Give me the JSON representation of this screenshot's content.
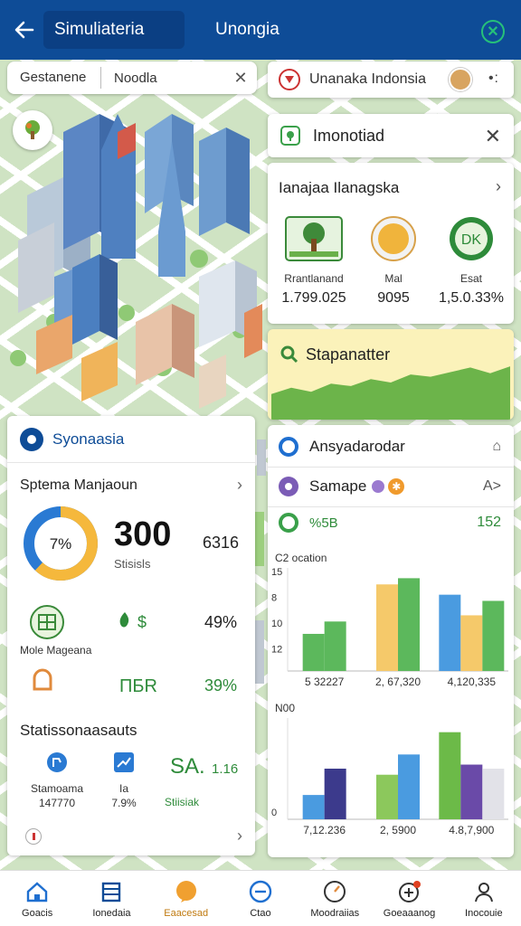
{
  "topbar": {
    "title_left": "Simuliateria",
    "title_center": "Unongia"
  },
  "search": {
    "scope": "Gestanene",
    "query": "Noodla"
  },
  "location_card": {
    "label": "Unanaka Indonsia"
  },
  "info_card": {
    "label": "Imonotiad"
  },
  "management_card": {
    "title": "Ianajaa Ilanagska",
    "items": [
      {
        "label": "Rrantlanand",
        "value": "1.799.025",
        "icon": "tree-icon"
      },
      {
        "label": "Mal",
        "value": "9095",
        "icon": "sun-icon"
      },
      {
        "label": "Esat",
        "value": "1,5.0.33%",
        "icon": "badge-icon",
        "badge_text": "DK"
      }
    ]
  },
  "stat_card": {
    "title": "Stapanatter",
    "area_values": [
      44,
      55,
      48,
      62,
      58,
      70,
      64,
      78,
      74,
      82,
      90,
      80,
      92
    ]
  },
  "right_rows": [
    {
      "label": "Ansyadarodar",
      "tail": "⌂"
    },
    {
      "label": "Samape",
      "tail": "A>"
    },
    {
      "label": "%5B",
      "tail": "152"
    }
  ],
  "chart_data": [
    {
      "type": "bar",
      "title": "C2 ocation",
      "yticks": [
        "15",
        "8",
        "10",
        "12"
      ],
      "categories": [
        "5 32227",
        "2, 67,320",
        "4,120,335"
      ],
      "series": [
        {
          "values": [
            36,
            84,
            70
          ],
          "color": "#5cb85c"
        },
        {
          "values": [
            48,
            0,
            0
          ],
          "color": "#f5c96a"
        },
        {
          "values": [
            0,
            0,
            56
          ],
          "color": "#4a9be0"
        }
      ],
      "bars": [
        [
          {
            "v": 36,
            "c": "#5cb85c"
          },
          {
            "v": 48,
            "c": "#5cb85c"
          }
        ],
        [
          {
            "v": 84,
            "c": "#f5c96a"
          },
          {
            "v": 90,
            "c": "#5cb85c"
          }
        ],
        [
          {
            "v": 74,
            "c": "#4a9be0"
          },
          {
            "v": 54,
            "c": "#f5c96a"
          },
          {
            "v": 68,
            "c": "#5cb85c"
          }
        ]
      ],
      "ylim": [
        0,
        100
      ]
    },
    {
      "type": "bar",
      "title": "N00",
      "yticks": [
        "0"
      ],
      "categories": [
        "7,12.236",
        "2, 5900",
        "4.8,7,900"
      ],
      "bars": [
        [
          {
            "v": 24,
            "c": "#4a9be0"
          },
          {
            "v": 50,
            "c": "#3c3a8c"
          }
        ],
        [
          {
            "v": 44,
            "c": "#8cc85c"
          },
          {
            "v": 64,
            "c": "#4a9be0"
          }
        ],
        [
          {
            "v": 86,
            "c": "#6cba48"
          },
          {
            "v": 54,
            "c": "#6a4aa8"
          },
          {
            "v": 50,
            "c": "#e2e2e8"
          }
        ]
      ],
      "ylim": [
        0,
        100
      ]
    }
  ],
  "left_card": {
    "title": "Syonaasia",
    "subtitle": "Sptema Manjaoun",
    "donut_label": "7%",
    "donut_percent": 62,
    "big_number": "300",
    "big_label": "Stisisls",
    "side_pct": "6316",
    "row1": {
      "caption": "Mole Mageana",
      "pct": "49%",
      "mid": "$"
    },
    "row2": {
      "mid": "ПБR",
      "pct": "39%"
    },
    "stats_title": "Statissonaasauts",
    "stats": [
      {
        "name": "Stamoama",
        "value": "147770"
      },
      {
        "name": "Ia",
        "value": "7.9%"
      }
    ],
    "big_sa": "SA.",
    "big_sa_side": "1.16",
    "sa_label": "Stiisiak"
  },
  "bottom_nav": [
    {
      "label": "Goacis",
      "icon": "home-icon"
    },
    {
      "label": "Ionedaia",
      "icon": "building-icon"
    },
    {
      "label": "Eaacesad",
      "icon": "bubble-icon"
    },
    {
      "label": "Ctao",
      "icon": "chat-icon"
    },
    {
      "label": "Moodraiias",
      "icon": "gauge-icon"
    },
    {
      "label": "Goeaaanog",
      "icon": "add-alert-icon"
    },
    {
      "label": "Inocouie",
      "icon": "person-icon"
    }
  ],
  "colors": {
    "brand": "#0e4c97",
    "accent_green": "#2e8b3a",
    "closebtn": "#26c07a"
  }
}
